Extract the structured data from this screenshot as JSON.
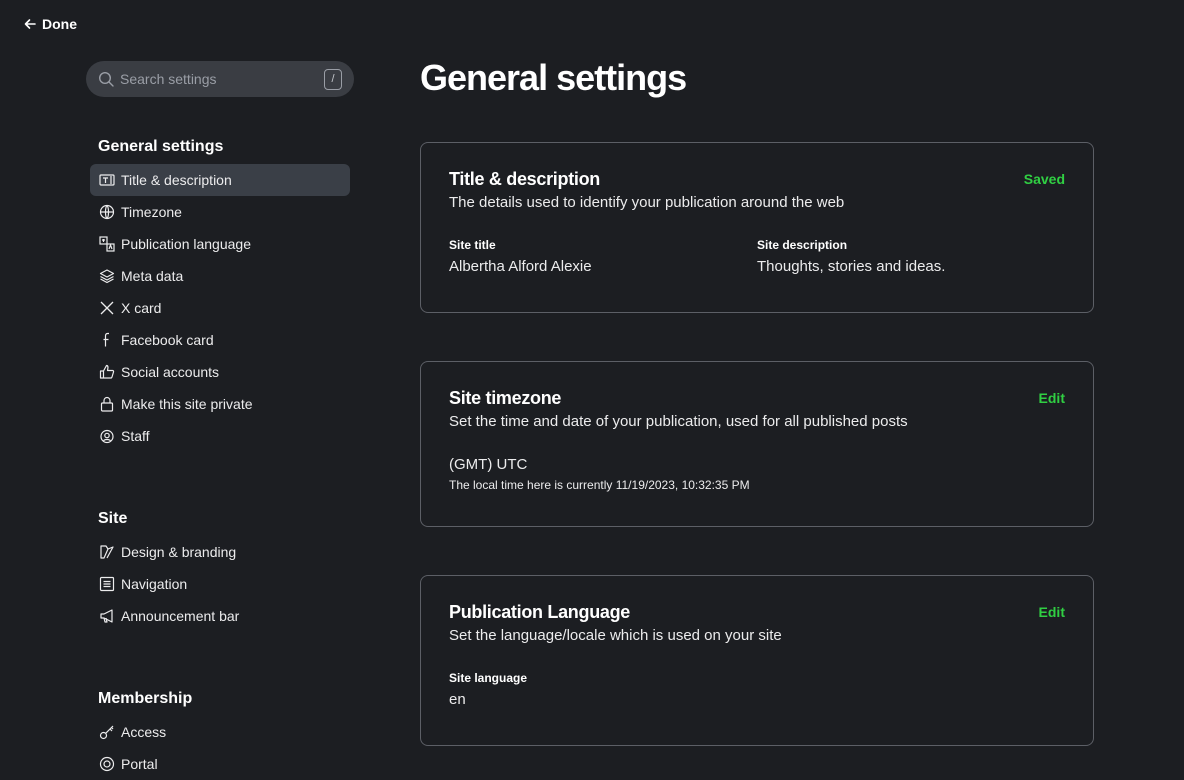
{
  "done": {
    "label": "Done"
  },
  "search": {
    "placeholder": "Search settings",
    "shortcut": "/"
  },
  "page_title": "General settings",
  "nav": {
    "groups": [
      {
        "heading": "General settings",
        "items": [
          {
            "label": "Title & description",
            "icon": "title-icon"
          },
          {
            "label": "Timezone",
            "icon": "globe-icon"
          },
          {
            "label": "Publication language",
            "icon": "translate-icon"
          },
          {
            "label": "Meta data",
            "icon": "layers-icon"
          },
          {
            "label": "X card",
            "icon": "x-icon"
          },
          {
            "label": "Facebook card",
            "icon": "facebook-icon"
          },
          {
            "label": "Social accounts",
            "icon": "thumbs-up-icon"
          },
          {
            "label": "Make this site private",
            "icon": "lock-icon"
          },
          {
            "label": "Staff",
            "icon": "staff-icon"
          }
        ]
      },
      {
        "heading": "Site",
        "items": [
          {
            "label": "Design & branding",
            "icon": "paintbrush-icon"
          },
          {
            "label": "Navigation",
            "icon": "list-icon"
          },
          {
            "label": "Announcement bar",
            "icon": "megaphone-icon"
          }
        ]
      },
      {
        "heading": "Membership",
        "items": [
          {
            "label": "Access",
            "icon": "key-icon"
          },
          {
            "label": "Portal",
            "icon": "portal-icon"
          }
        ]
      }
    ]
  },
  "cards": {
    "title_description": {
      "title": "Title & description",
      "description": "The details used to identify your publication around the web",
      "action": "Saved",
      "site_title_label": "Site title",
      "site_title_value": "Albertha Alford Alexie",
      "site_description_label": "Site description",
      "site_description_value": "Thoughts, stories and ideas."
    },
    "timezone": {
      "title": "Site timezone",
      "description": "Set the time and date of your publication, used for all published posts",
      "action": "Edit",
      "value": "(GMT) UTC",
      "note": "The local time here is currently 11/19/2023, 10:32:35 PM"
    },
    "language": {
      "title": "Publication Language",
      "description": "Set the language/locale which is used on your site",
      "action": "Edit",
      "field_label": "Site language",
      "field_value": "en"
    }
  },
  "colors": {
    "accent": "#30cf43",
    "background": "#1c1e22",
    "active_item": "#3a3f47"
  }
}
